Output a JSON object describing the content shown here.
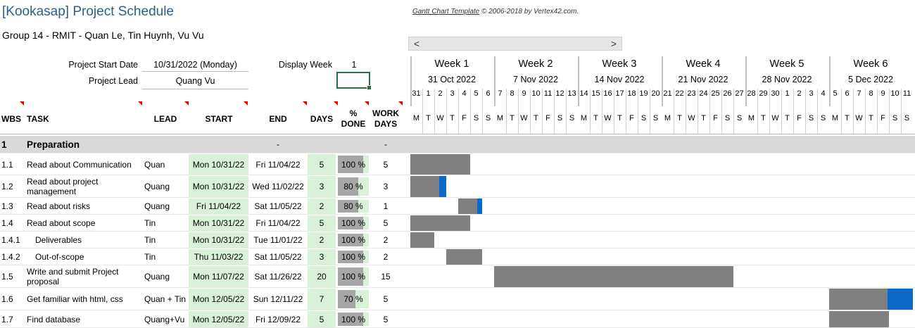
{
  "title": "[Kookasap] Project Schedule",
  "subtitle": "Group 14 - RMIT - Quan Le, Tin Huynh, Vu Vu",
  "credit_link": "Gantt Chart Template",
  "credit_rest": " © 2006-2018 by Vertex42.com.",
  "scroll_left": "<",
  "scroll_right": ">",
  "project_start_label": "Project Start Date",
  "project_start_value": "10/31/2022 (Monday)",
  "project_lead_label": "Project Lead",
  "project_lead_value": "Quang Vu",
  "display_week_label": "Display Week",
  "display_week_value": "1",
  "headers": {
    "wbs": "WBS",
    "task": "TASK",
    "lead": "LEAD",
    "start": "START",
    "end": "END",
    "days": "DAYS",
    "pct": "% DONE",
    "work_days": "WORK DAYS"
  },
  "weeks": [
    {
      "name": "Week 1",
      "date": "31 Oct 2022",
      "days": [
        "31",
        "1",
        "2",
        "3",
        "4",
        "5",
        "6"
      ]
    },
    {
      "name": "Week 2",
      "date": "7 Nov 2022",
      "days": [
        "7",
        "8",
        "9",
        "10",
        "11",
        "12",
        "13"
      ]
    },
    {
      "name": "Week 3",
      "date": "14 Nov 2022",
      "days": [
        "14",
        "15",
        "16",
        "17",
        "18",
        "19",
        "20"
      ]
    },
    {
      "name": "Week 4",
      "date": "21 Nov 2022",
      "days": [
        "21",
        "22",
        "23",
        "24",
        "25",
        "26",
        "27"
      ]
    },
    {
      "name": "Week 5",
      "date": "28 Nov 2022",
      "days": [
        "28",
        "29",
        "30",
        "1",
        "2",
        "3",
        "4"
      ]
    },
    {
      "name": "Week 6",
      "date": "5 Dec 2022",
      "days": [
        "5",
        "6",
        "7",
        "8",
        "9",
        "10",
        "11"
      ]
    }
  ],
  "dow": [
    "M",
    "T",
    "W",
    "T",
    "F",
    "S",
    "S"
  ],
  "phase": {
    "wbs": "1",
    "task": "Preparation",
    "end": "-",
    "work_days": "-"
  },
  "tasks": [
    {
      "wbs": "1.1",
      "task": "Read about Communication",
      "lead": "Quan",
      "start": "Mon 10/31/22",
      "end": "Fri 11/04/22",
      "days": "5",
      "pct": "100 %",
      "pct_value": 100,
      "work_days": "5",
      "bar_start_day": 0,
      "bar_len_days": 5
    },
    {
      "wbs": "1.2",
      "task": "Read about project management",
      "lead": "Quang",
      "start": "Mon 10/31/22",
      "end": "Wed 11/02/22",
      "days": "3",
      "pct": "80 %",
      "pct_value": 80,
      "work_days": "3",
      "bar_start_day": 0,
      "bar_len_days": 3
    },
    {
      "wbs": "1.3",
      "task": "Read about risks",
      "lead": "Quang",
      "start": "Fri 11/04/22",
      "end": "Sat 11/05/22",
      "days": "2",
      "pct": "80 %",
      "pct_value": 80,
      "work_days": "1",
      "bar_start_day": 4,
      "bar_len_days": 2
    },
    {
      "wbs": "1.4",
      "task": "Read about scope",
      "lead": "Tin",
      "start": "Mon 10/31/22",
      "end": "Fri 11/04/22",
      "days": "5",
      "pct": "100 %",
      "pct_value": 100,
      "work_days": "5",
      "bar_start_day": 0,
      "bar_len_days": 5
    },
    {
      "wbs": "1.4.1",
      "task": "Deliverables",
      "lead": "Tin",
      "start": "Mon 10/31/22",
      "end": "Tue 11/01/22",
      "days": "2",
      "pct": "100 %",
      "pct_value": 100,
      "work_days": "2",
      "bar_start_day": 0,
      "bar_len_days": 2,
      "indent": true
    },
    {
      "wbs": "1.4.2",
      "task": "Out-of-scope",
      "lead": "Tin",
      "start": "Thu 11/03/22",
      "end": "Sat 11/05/22",
      "days": "3",
      "pct": "100 %",
      "pct_value": 100,
      "work_days": "2",
      "bar_start_day": 3,
      "bar_len_days": 3,
      "indent": true
    },
    {
      "wbs": "1.5",
      "task": "Write and submit Project proposal",
      "lead": "Quang",
      "start": "Mon 11/07/22",
      "end": "Sat 11/26/22",
      "days": "20",
      "pct": "100 %",
      "pct_value": 100,
      "work_days": "15",
      "bar_start_day": 7,
      "bar_len_days": 20
    },
    {
      "wbs": "1.6",
      "task": "Get familiar with html, css",
      "lead": "Quan + Tin",
      "start": "Mon 12/05/22",
      "end": "Sun 12/11/22",
      "days": "7",
      "pct": "70 %",
      "pct_value": 70,
      "work_days": "5",
      "bar_start_day": 35,
      "bar_len_days": 7
    },
    {
      "wbs": "1.7",
      "task": "Find database",
      "lead": "Quang+Vu",
      "start": "Mon 12/05/22",
      "end": "Fri 12/09/22",
      "days": "5",
      "pct": "100 %",
      "pct_value": 100,
      "work_days": "5",
      "bar_start_day": 35,
      "bar_len_days": 5
    }
  ]
}
